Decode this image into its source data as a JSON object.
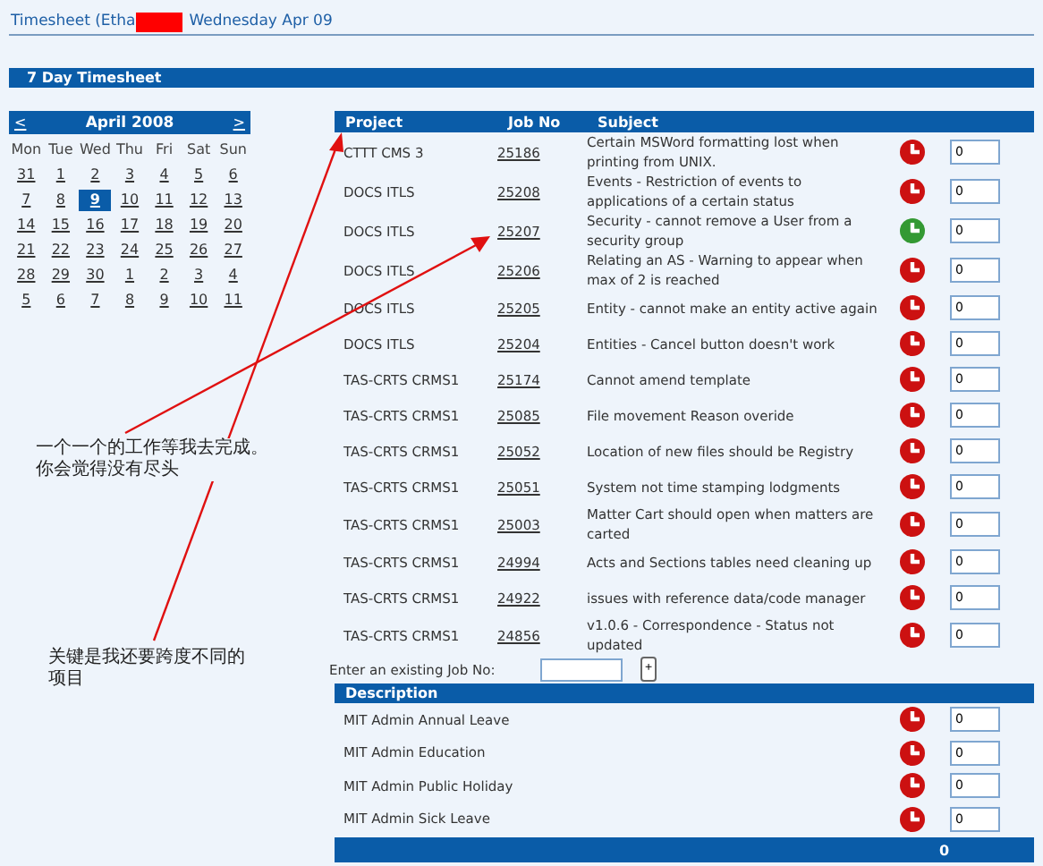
{
  "title": {
    "text_before": "Timesheet (Etha",
    "text_after": "Wednesday Apr 09"
  },
  "section_title": "7 Day Timesheet",
  "calendar": {
    "prev": "<",
    "month": "April 2008",
    "next": ">",
    "weekdays": [
      "Mon",
      "Tue",
      "Wed",
      "Thu",
      "Fri",
      "Sat",
      "Sun"
    ],
    "weeks": [
      [
        {
          "day": "31",
          "selected": false
        },
        {
          "day": "1",
          "selected": false
        },
        {
          "day": "2",
          "selected": false
        },
        {
          "day": "3",
          "selected": false
        },
        {
          "day": "4",
          "selected": false
        },
        {
          "day": "5",
          "selected": false
        },
        {
          "day": "6",
          "selected": false
        }
      ],
      [
        {
          "day": "7",
          "selected": false
        },
        {
          "day": "8",
          "selected": false
        },
        {
          "day": "9",
          "selected": true
        },
        {
          "day": "10",
          "selected": false
        },
        {
          "day": "11",
          "selected": false
        },
        {
          "day": "12",
          "selected": false
        },
        {
          "day": "13",
          "selected": false
        }
      ],
      [
        {
          "day": "14",
          "selected": false
        },
        {
          "day": "15",
          "selected": false
        },
        {
          "day": "16",
          "selected": false
        },
        {
          "day": "17",
          "selected": false
        },
        {
          "day": "18",
          "selected": false
        },
        {
          "day": "19",
          "selected": false
        },
        {
          "day": "20",
          "selected": false
        }
      ],
      [
        {
          "day": "21",
          "selected": false
        },
        {
          "day": "22",
          "selected": false
        },
        {
          "day": "23",
          "selected": false
        },
        {
          "day": "24",
          "selected": false
        },
        {
          "day": "25",
          "selected": false
        },
        {
          "day": "26",
          "selected": false
        },
        {
          "day": "27",
          "selected": false
        }
      ],
      [
        {
          "day": "28",
          "selected": false
        },
        {
          "day": "29",
          "selected": false
        },
        {
          "day": "30",
          "selected": false
        },
        {
          "day": "1",
          "selected": false
        },
        {
          "day": "2",
          "selected": false
        },
        {
          "day": "3",
          "selected": false
        },
        {
          "day": "4",
          "selected": false
        }
      ],
      [
        {
          "day": "5",
          "selected": false
        },
        {
          "day": "6",
          "selected": false
        },
        {
          "day": "7",
          "selected": false
        },
        {
          "day": "8",
          "selected": false
        },
        {
          "day": "9",
          "selected": false
        },
        {
          "day": "10",
          "selected": false
        },
        {
          "day": "11",
          "selected": false
        }
      ]
    ]
  },
  "jobs": {
    "columns": [
      "Project",
      "Job No",
      "Subject"
    ],
    "rows": [
      {
        "project": "CTTT CMS 3",
        "job_no": "25186",
        "subject": "Certain MSWord formatting lost when printing from UNIX.",
        "color": "#cc1111",
        "hours": "0"
      },
      {
        "project": "DOCS ITLS",
        "job_no": "25208",
        "subject": "Events - Restriction of events to applications of a certain status",
        "color": "#cc1111",
        "hours": "0"
      },
      {
        "project": "DOCS ITLS",
        "job_no": "25207",
        "subject": "Security - cannot remove a User from a security group",
        "color": "#339933",
        "hours": "0"
      },
      {
        "project": "DOCS ITLS",
        "job_no": "25206",
        "subject": "Relating an AS - Warning to appear when max of 2 is reached",
        "color": "#cc1111",
        "hours": "0"
      },
      {
        "project": "DOCS ITLS",
        "job_no": "25205",
        "subject": "Entity - cannot make an entity active again",
        "color": "#cc1111",
        "hours": "0"
      },
      {
        "project": "DOCS ITLS",
        "job_no": "25204",
        "subject": "Entities - Cancel button doesn't work",
        "color": "#cc1111",
        "hours": "0"
      },
      {
        "project": "TAS-CRTS CRMS1",
        "job_no": "25174",
        "subject": "Cannot amend template",
        "color": "#cc1111",
        "hours": "0"
      },
      {
        "project": "TAS-CRTS CRMS1",
        "job_no": "25085",
        "subject": "File movement Reason overide",
        "color": "#cc1111",
        "hours": "0"
      },
      {
        "project": "TAS-CRTS CRMS1",
        "job_no": "25052",
        "subject": "Location of new files should be Registry",
        "color": "#cc1111",
        "hours": "0"
      },
      {
        "project": "TAS-CRTS CRMS1",
        "job_no": "25051",
        "subject": "System not time stamping lodgments",
        "color": "#cc1111",
        "hours": "0"
      },
      {
        "project": "TAS-CRTS CRMS1",
        "job_no": "25003",
        "subject": "Matter Cart should open when matters are carted",
        "color": "#cc1111",
        "hours": "0"
      },
      {
        "project": "TAS-CRTS CRMS1",
        "job_no": "24994",
        "subject": "Acts and Sections tables need cleaning up",
        "color": "#cc1111",
        "hours": "0"
      },
      {
        "project": "TAS-CRTS CRMS1",
        "job_no": "24922",
        "subject": "issues with reference data/code manager",
        "color": "#cc1111",
        "hours": "0"
      },
      {
        "project": "TAS-CRTS CRMS1",
        "job_no": "24856",
        "subject": "v1.0.6 - Correspondence - Status not updated",
        "color": "#cc1111",
        "hours": "0"
      }
    ]
  },
  "job_entry": {
    "label": "Enter an existing Job No:",
    "button": "+"
  },
  "admin": {
    "column": "Description",
    "rows": [
      {
        "description": "MIT Admin Annual Leave",
        "color": "#cc1111",
        "hours": "0"
      },
      {
        "description": "MIT Admin Education",
        "color": "#cc1111",
        "hours": "0"
      },
      {
        "description": "MIT Admin Public Holiday",
        "color": "#cc1111",
        "hours": "0"
      },
      {
        "description": "MIT Admin Sick Leave",
        "color": "#cc1111",
        "hours": "0"
      }
    ],
    "total": "0"
  },
  "annotations": [
    "一个一个的工作等我去完成。你会觉得没有尽头",
    "关键是我还要跨度不同的项目"
  ]
}
